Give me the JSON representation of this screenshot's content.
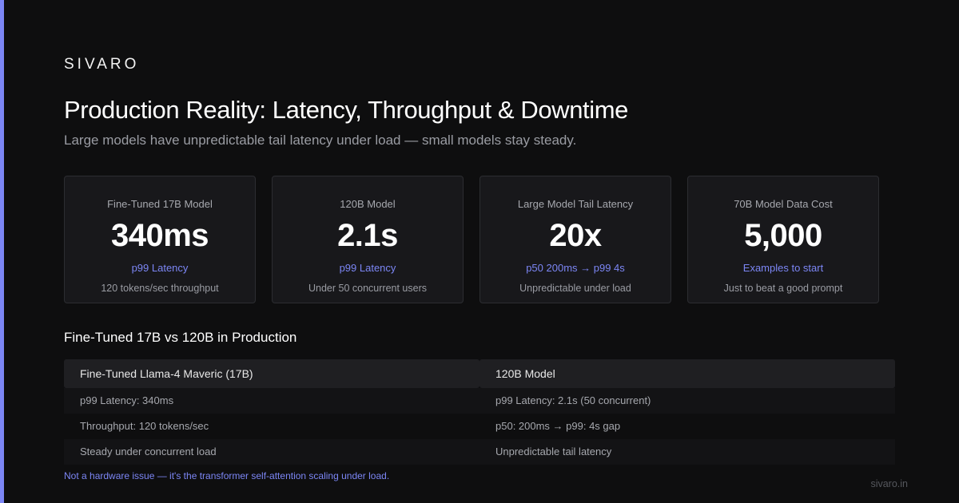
{
  "brand": "SIVARO",
  "title": "Production Reality: Latency, Throughput & Downtime",
  "subtitle": "Large models have unpredictable tail latency under load — small models stay steady.",
  "accent_color": "#7c86f5",
  "stats": [
    {
      "label": "Fine-Tuned 17B Model",
      "value": "340ms",
      "accent": "p99 Latency",
      "note": "120 tokens/sec throughput"
    },
    {
      "label": "120B Model",
      "value": "2.1s",
      "accent": "p99 Latency",
      "note": "Under 50 concurrent users"
    },
    {
      "label": "Large Model Tail Latency",
      "value": "20x",
      "accent": "p50 200ms → p99 4s",
      "note": "Unpredictable under load"
    },
    {
      "label": "70B Model Data Cost",
      "value": "5,000",
      "accent": "Examples to start",
      "note": "Just to beat a good prompt"
    }
  ],
  "comparison": {
    "title": "Fine-Tuned 17B vs 120B in Production",
    "columns": [
      {
        "header": "Fine-Tuned Llama-4 Maveric (17B)",
        "rows": [
          "p99 Latency: 340ms",
          "Throughput: 120 tokens/sec",
          "Steady under concurrent load"
        ]
      },
      {
        "header": "120B Model",
        "rows": [
          "p99 Latency: 2.1s (50 concurrent)",
          "p50: 200ms → p99: 4s gap",
          "Unpredictable tail latency"
        ]
      }
    ]
  },
  "footnote": "Not a hardware issue — it's the transformer self-attention scaling under load.",
  "domain": "sivaro.in"
}
